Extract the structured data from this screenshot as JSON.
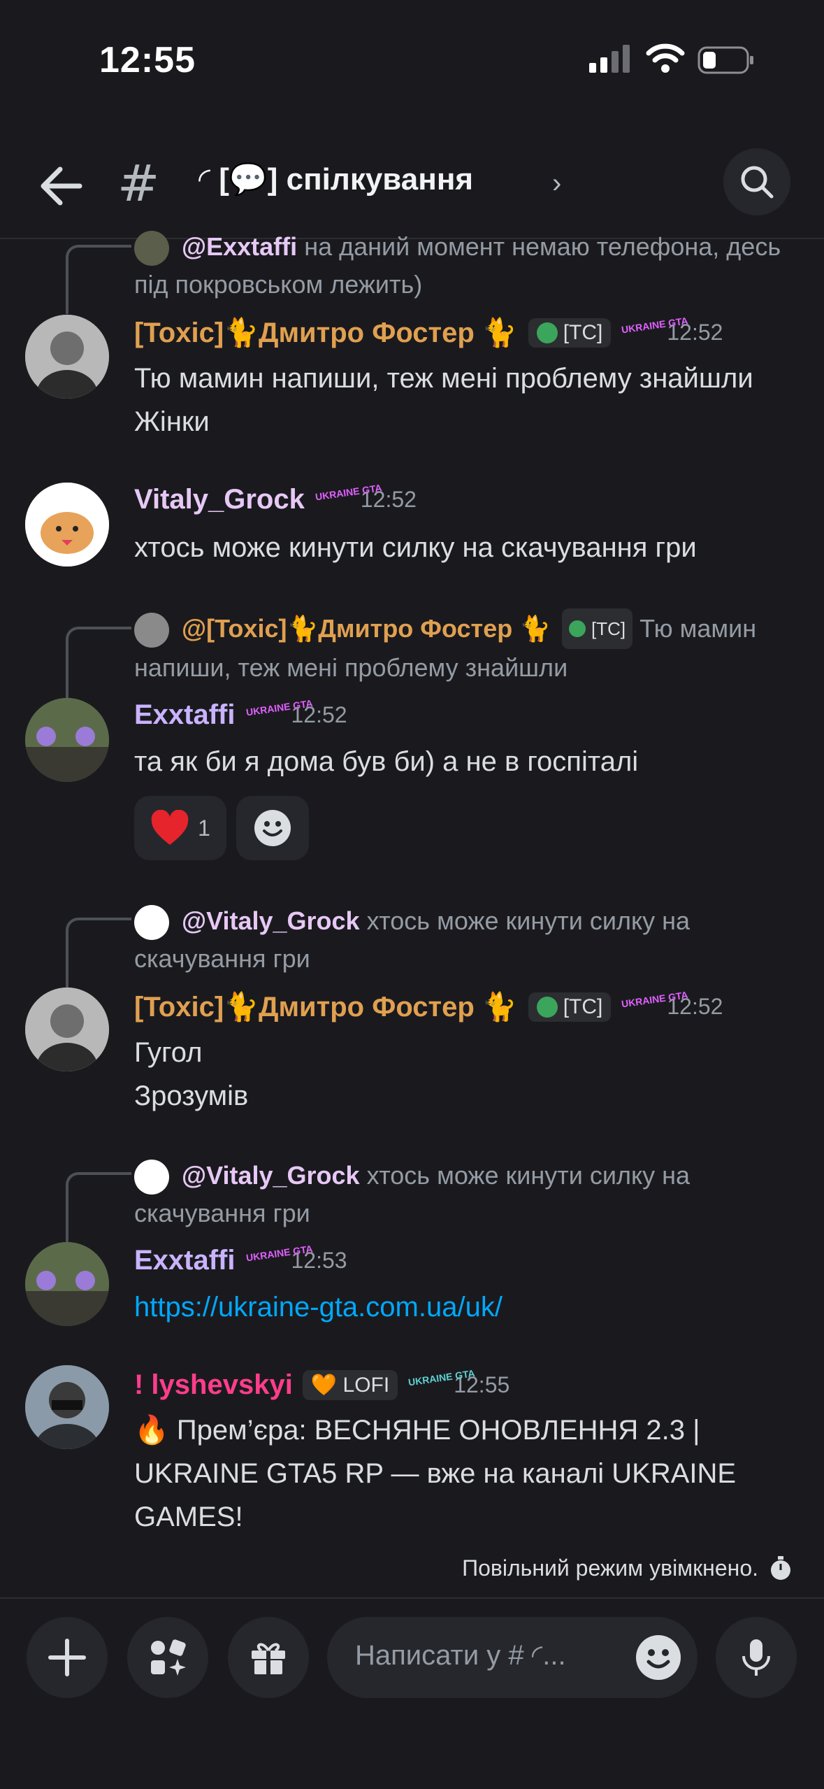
{
  "status": {
    "time": "12:55"
  },
  "header": {
    "channel_name": "[💬] спілкування",
    "channel_prefix": "◜"
  },
  "messages": [
    {
      "reply": {
        "name": "@Exxtaffi",
        "text": "на даний момент немаю телефона, десь під покровськом лежить)"
      }
    },
    {
      "author": "[Toxic]🐈Дмитро Фостер 🐈",
      "badge": "[TC]",
      "server_tag": "UKRAINE GTA",
      "time": "12:52",
      "lines": [
        "Тю мамин напиши, теж мені проблему знайшли",
        "Жінки"
      ]
    },
    {
      "author": "Vitaly_Grock",
      "server_tag": "UKRAINE GTA",
      "time": "12:52",
      "lines": [
        "хтось може кинути силку на скачування гри"
      ]
    },
    {
      "reply": {
        "name": "@[Toxic]🐈Дмитро Фостер 🐈",
        "badge": "[TC]",
        "text": "Тю мамин напиши, теж мені проблему знайшли"
      },
      "author": "Exxtaffi",
      "server_tag": "UKRAINE GTA",
      "time": "12:52",
      "lines": [
        "та як би я дома був би) а не в госпіталі"
      ],
      "reactions": [
        {
          "emoji": "❤️",
          "count": "1"
        }
      ]
    },
    {
      "reply": {
        "name": "@Vitaly_Grock",
        "text": "хтось може кинути силку на скачування гри"
      },
      "author": "[Toxic]🐈Дмитро Фостер 🐈",
      "badge": "[TC]",
      "server_tag": "UKRAINE GTA",
      "time": "12:52",
      "lines": [
        "Гугол",
        "Зрозумів"
      ]
    },
    {
      "reply": {
        "name": "@Vitaly_Grock",
        "text": "хтось може кинути силку на скачування гри"
      },
      "author": "Exxtaffi",
      "server_tag": "UKRAINE GTA",
      "time": "12:53",
      "lines": [
        "https://ukraine-gta.com.ua/uk/"
      ]
    },
    {
      "author": "! lyshevskyi",
      "badge": "🧡 LOFI",
      "server_tag": "UKRAINE GTA",
      "time": "12:55",
      "lines": [
        "🔥 Прем’єра: ВЕСНЯНЕ ОНОВЛЕННЯ 2.3 | UKRAINE GTA5 RP — вже на каналі UKRAINE GAMES!"
      ]
    }
  ],
  "slow_mode": "Повільний режим увімкнено.",
  "composer": {
    "placeholder": "Написати у # ◜..."
  },
  "colors": {
    "toxic": "#e0a050",
    "vitaly": "#e7c8f5",
    "exxtaffi": "#c9b3ff",
    "lyshevskyi": "#ff3d8b",
    "link": "#00a8fc",
    "background": "#1a1a1e"
  }
}
